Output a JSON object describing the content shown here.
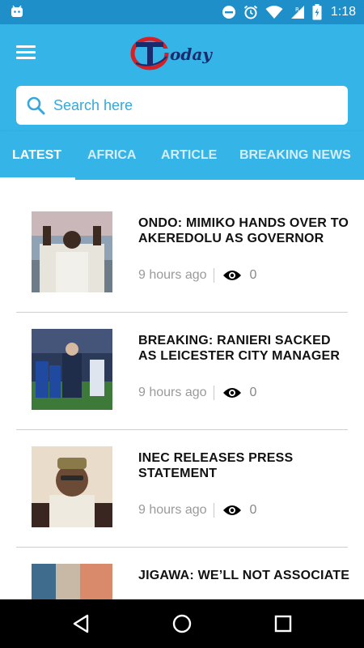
{
  "status_bar": {
    "time": "1:18",
    "icons": [
      "android-notification-icon",
      "do-not-disturb-icon",
      "alarm-icon",
      "wifi-icon",
      "signal-icon",
      "battery-charging-icon"
    ]
  },
  "app_bar": {
    "logo_text": "oday",
    "logo_colors": {
      "ring": "#d42027",
      "letter": "#1a2b6d",
      "accent": "#35b4e8"
    }
  },
  "search": {
    "placeholder": "Search here"
  },
  "tabs": [
    {
      "label": "LATEST",
      "active": true
    },
    {
      "label": "AFRICA",
      "active": false
    },
    {
      "label": "ARTICLE",
      "active": false
    },
    {
      "label": "BREAKING NEWS",
      "active": false
    }
  ],
  "articles": [
    {
      "title": "ONDO: MIMIKO HANDS OVER TO AKEREDOLU AS GOVERNOR",
      "time": "9 hours ago",
      "views": "0",
      "thumb": "politician-raising-fists"
    },
    {
      "title": "BREAKING: RANIERI SACKED AS LEICESTER CITY MANAGER",
      "time": "9 hours ago",
      "views": "0",
      "thumb": "football-manager-on-pitch"
    },
    {
      "title": "INEC RELEASES PRESS STATEMENT",
      "time": "9 hours ago",
      "views": "0",
      "thumb": "inec-chairman-portrait"
    },
    {
      "title": "JIGAWA: WE’LL NOT ASSOCIATE",
      "time": "",
      "views": "",
      "thumb": "crowd-banner"
    }
  ],
  "colors": {
    "primary": "#35b4e8",
    "status_bar": "#1e8fc9",
    "nav_bar": "#000000"
  }
}
